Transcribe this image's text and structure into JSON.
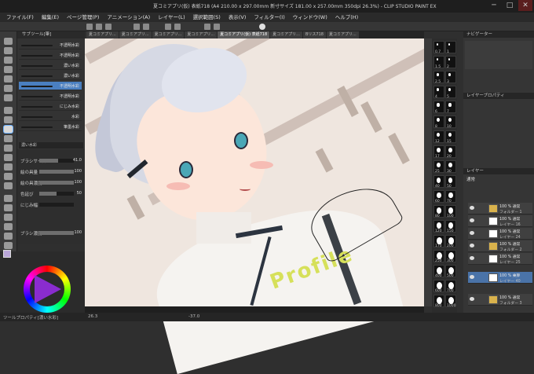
{
  "app": {
    "title": "夏コミアプリ(仮) 表紙718 (A4 210.00 x 297.00mm 新寸サイズ 181.00 x 257.00mm 350dpi 26.3%) - CLIP STUDIO PAINT EX"
  },
  "window_controls": {
    "minimize": "─",
    "maximize": "□",
    "close": "✕"
  },
  "menu": [
    "ファイル(F)",
    "編集(E)",
    "ページ管理(P)",
    "アニメーション(A)",
    "レイヤー(L)",
    "選択範囲(S)",
    "表示(V)",
    "フィルター(I)",
    "ウィンドウ(W)",
    "ヘルプ(H)"
  ],
  "tabs": [
    {
      "label": "夏コミアプリ...",
      "active": false
    },
    {
      "label": "夏コミアプリ...",
      "active": false
    },
    {
      "label": "夏コミアプリ...",
      "active": false
    },
    {
      "label": "夏コミアプリ...",
      "active": false
    },
    {
      "label": "夏コミアプリ(仮) 表紙718",
      "active": true
    },
    {
      "label": "夏コミアプリ...",
      "active": false
    },
    {
      "label": "Bリス718",
      "active": false
    },
    {
      "label": "夏コミアプリ...",
      "active": false
    }
  ],
  "sub_tool": {
    "header": "サブツール[筆]",
    "brushes": [
      {
        "label": "不透明水彩",
        "selected": false
      },
      {
        "label": "不透明水彩",
        "selected": false
      },
      {
        "label": "濃い水彩",
        "selected": false
      },
      {
        "label": "濃い水彩",
        "selected": false
      },
      {
        "label": "不透明水彩",
        "selected": true
      },
      {
        "label": "不透明水彩",
        "selected": false
      },
      {
        "label": "にじみ水彩",
        "selected": false
      },
      {
        "label": "水彩",
        "selected": false
      },
      {
        "label": "筆墨水彩",
        "selected": false
      }
    ]
  },
  "tool_property": {
    "name": "濃い水彩",
    "rows": [
      {
        "label": "ブラシサイズ",
        "value": "41.0",
        "level": 0.55
      },
      {
        "label": "絵の具量",
        "value": "100",
        "level": 1.0
      },
      {
        "label": "絵の具濃度",
        "value": "100",
        "level": 1.0
      },
      {
        "label": "色延び",
        "value": "50",
        "level": 0.5
      },
      {
        "label": "にじみ幅",
        "value": "",
        "level": 0.0
      },
      {
        "label": "ブラシ濃度",
        "value": "100",
        "level": 1.0
      }
    ]
  },
  "brush_sizes": [
    "0.7",
    "1",
    "1.5",
    "2",
    "2.5",
    "3",
    "4",
    "5",
    "6",
    "7",
    "8",
    "10",
    "12",
    "15",
    "17",
    "20",
    "25",
    "30",
    "40",
    "50",
    "60",
    "70",
    "80",
    "100",
    "120",
    "150",
    "170",
    "200",
    "250",
    "300",
    "400",
    "500",
    "600",
    "700",
    "800",
    "1000"
  ],
  "panels": {
    "navigator": "ナビゲーター",
    "layer_property": "レイヤープロパティ",
    "layer": "レイヤー"
  },
  "layer_blend": "通常",
  "layers": [
    {
      "name": "100 % 通常",
      "sub": "フォルダー 1",
      "folder": true,
      "selected": false
    },
    {
      "name": "100 % 通常",
      "sub": "レイヤー 16",
      "folder": false,
      "selected": false
    },
    {
      "name": "100 % 通常",
      "sub": "レイヤー 24",
      "folder": false,
      "selected": false
    },
    {
      "name": "100 % 通常",
      "sub": "フォルダー 2",
      "folder": true,
      "selected": false
    },
    {
      "name": "100 % 通常",
      "sub": "レイヤー 25",
      "folder": false,
      "selected": false
    },
    {
      "name": "100 % 乗算",
      "sub": "レイヤー 40",
      "folder": false,
      "selected": true
    },
    {
      "name": "100 % 通常",
      "sub": "フォルダー 3",
      "folder": true,
      "selected": false
    }
  ],
  "status": {
    "zoom": "26.3",
    "angle": "-37.0",
    "left_note": "ツールプロパティ[濃い水彩]"
  },
  "canvas_overlay_text": "Profile"
}
